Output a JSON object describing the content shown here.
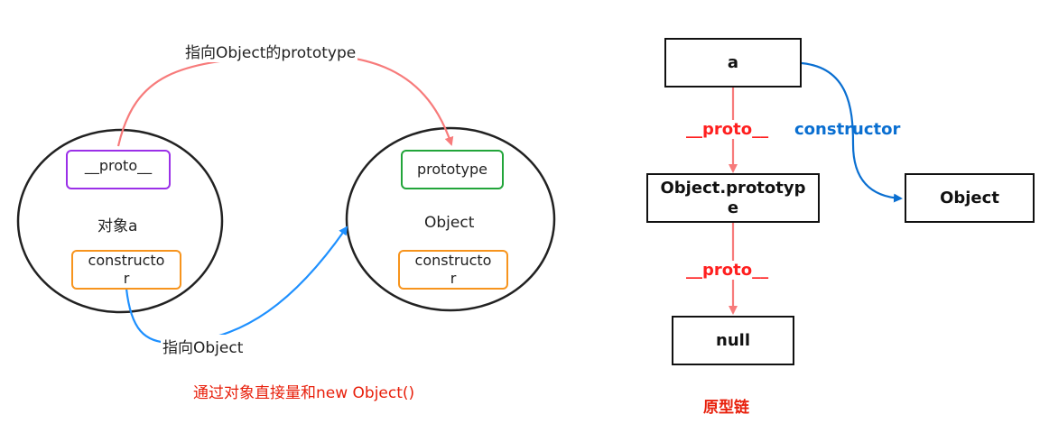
{
  "left_diagram": {
    "arc_top_label": "指向Object的prototype",
    "object_a": {
      "proto_box": "__proto__",
      "center_label": "对象a",
      "constructor_box": "constructor"
    },
    "object_ctor": {
      "prototype_box": "prototype",
      "center_label": "Object",
      "constructor_box": "constructor"
    },
    "arc_bottom_label": "指向Object",
    "caption": "通过对象直接量和new Object()"
  },
  "right_diagram": {
    "box_a": "a",
    "proto_label_1": "__proto__",
    "constructor_label": "constructor",
    "box_object_prototype": "Object.prototype",
    "box_object": "Object",
    "proto_label_2": "__proto__",
    "box_null": "null",
    "caption": "原型链"
  },
  "colors": {
    "proto_arrow": "#f77b7b",
    "constructor_arrow": "#1e90ff",
    "constructor_label": "#0a6fd1",
    "caption_red": "#e8200c",
    "proto_label": "#ff1f1f",
    "proto_box_border": "#9b30e8",
    "prototype_box_border": "#22a53a",
    "constructor_box_border": "#f7941d"
  }
}
